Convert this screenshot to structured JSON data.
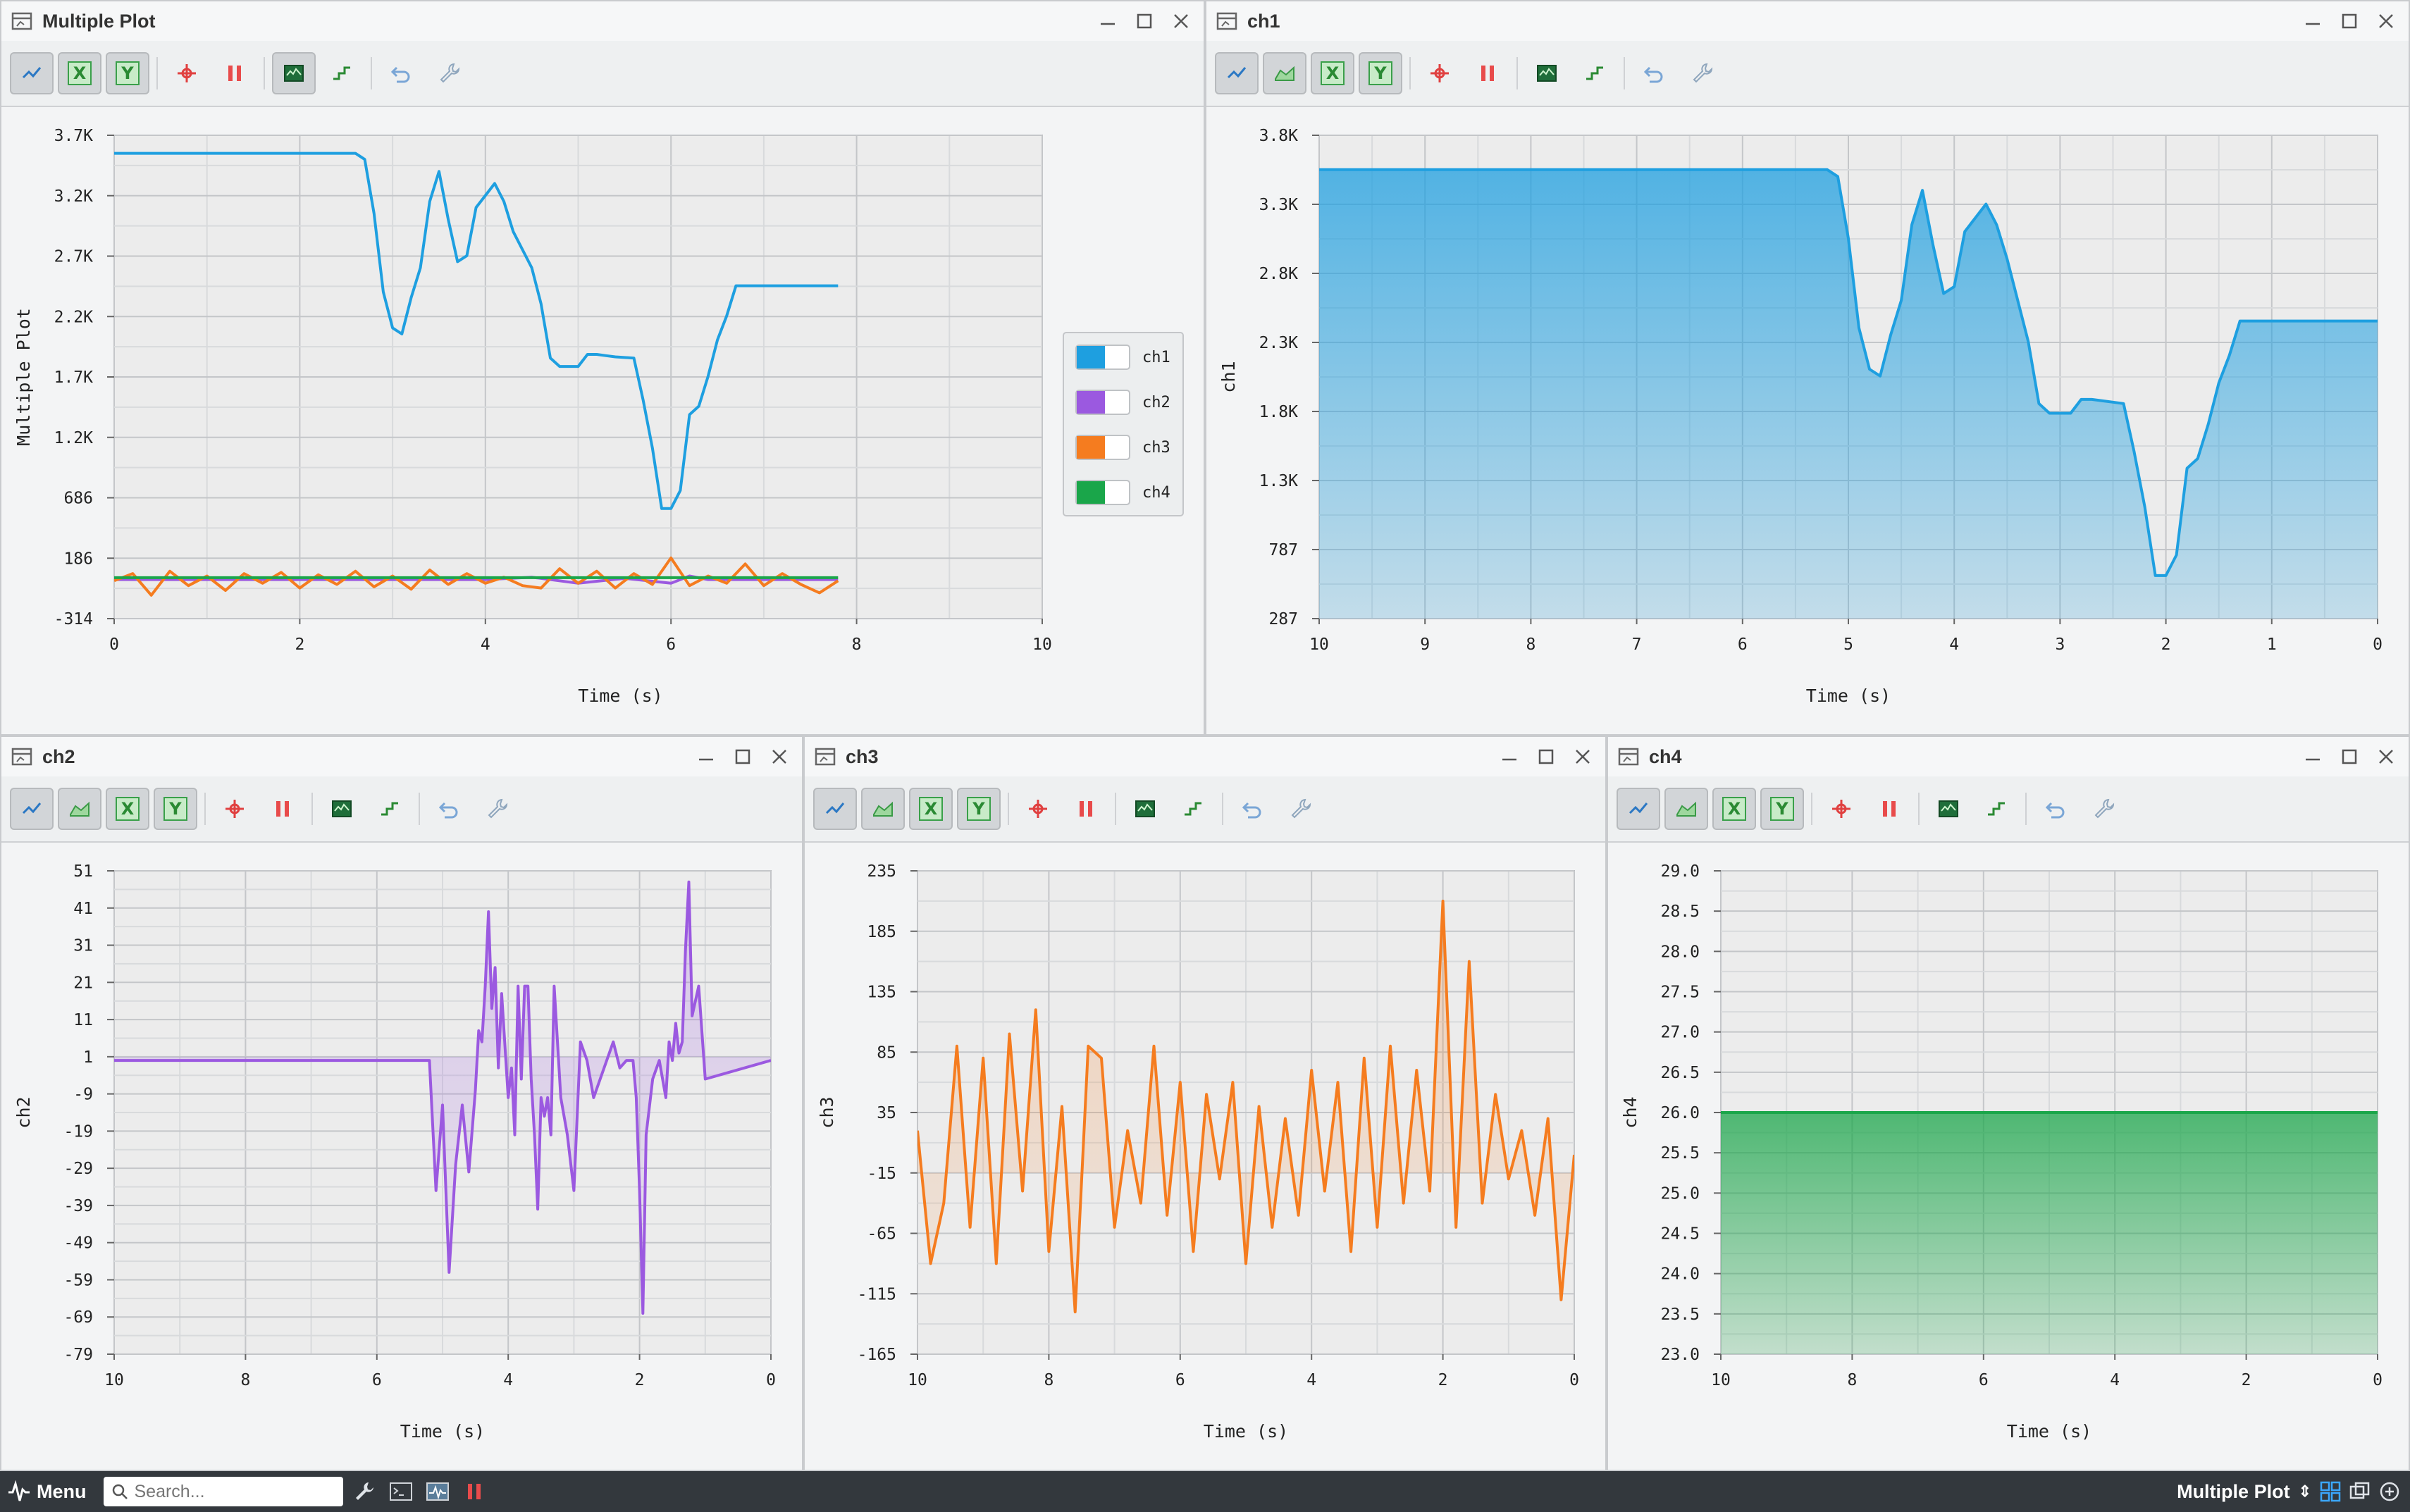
{
  "panels": [
    {
      "id": "p0",
      "title": "Multiple Plot",
      "tools": [
        "line",
        "x",
        "y",
        "move",
        "pause",
        "screenshot",
        "step",
        "undo",
        "settings"
      ]
    },
    {
      "id": "p1",
      "title": "ch1",
      "tools": [
        "line",
        "area",
        "x",
        "y",
        "move",
        "pause",
        "screenshot",
        "step",
        "undo",
        "settings"
      ]
    },
    {
      "id": "p2",
      "title": "ch2",
      "tools": [
        "line",
        "area",
        "x",
        "y",
        "move",
        "pause",
        "screenshot",
        "step",
        "undo",
        "settings"
      ]
    },
    {
      "id": "p3",
      "title": "ch3",
      "tools": [
        "line",
        "area",
        "x",
        "y",
        "move",
        "pause",
        "screenshot",
        "step",
        "undo",
        "settings"
      ]
    },
    {
      "id": "p4",
      "title": "ch4",
      "tools": [
        "line",
        "area",
        "x",
        "y",
        "move",
        "pause",
        "screenshot",
        "step",
        "undo",
        "settings"
      ]
    }
  ],
  "toolbar_labels": {
    "x": "X",
    "y": "Y"
  },
  "taskbar": {
    "menu_label": "Menu",
    "search_placeholder": "Search...",
    "active_window": "Multiple Plot"
  },
  "colors": {
    "ch1": "#1e9fe0",
    "ch2": "#9b59e0",
    "ch3": "#f57c1f",
    "ch4": "#1aa64a",
    "panel_bg": "#f3f4f5",
    "grid": "#c4c6c9",
    "taskbar": "#33383d"
  },
  "chart_data": [
    {
      "panel": "Multiple Plot",
      "type": "line",
      "xlabel": "Time (s)",
      "ylabel": "Multiple Plot",
      "xlim": [
        0,
        10
      ],
      "ylim": [
        -314,
        3700
      ],
      "xticks": [
        "0",
        "2",
        "4",
        "6",
        "8",
        "10"
      ],
      "yticks": [
        "3.7K",
        "3.2K",
        "2.7K",
        "2.2K",
        "1.7K",
        "1.2K",
        "686",
        "186",
        "-314"
      ],
      "legend": [
        "ch1",
        "ch2",
        "ch3",
        "ch4"
      ],
      "legend_position": "right",
      "series": [
        {
          "name": "ch1",
          "color": "#1e9fe0",
          "x": [
            0,
            2.6,
            2.7,
            2.8,
            2.9,
            3.0,
            3.1,
            3.2,
            3.3,
            3.4,
            3.5,
            3.6,
            3.7,
            3.8,
            3.9,
            4.0,
            4.1,
            4.2,
            4.3,
            4.5,
            4.6,
            4.7,
            4.8,
            4.9,
            5.0,
            5.1,
            5.2,
            5.3,
            5.4,
            5.6,
            5.7,
            5.8,
            5.9,
            6.0,
            6.1,
            6.2,
            6.3,
            6.4,
            6.5,
            6.6,
            6.7,
            7.0,
            7.4,
            7.8
          ],
          "y": [
            3550,
            3550,
            3500,
            3050,
            2400,
            2100,
            2050,
            2350,
            2600,
            3150,
            3400,
            3000,
            2650,
            2700,
            3100,
            3200,
            3300,
            3150,
            2900,
            2600,
            2300,
            1850,
            1780,
            1780,
            1780,
            1880,
            1880,
            1870,
            1860,
            1850,
            1500,
            1100,
            600,
            600,
            750,
            1380,
            1450,
            1700,
            2000,
            2200,
            2450,
            2450,
            2450,
            2450
          ]
        },
        {
          "name": "ch2",
          "color": "#9b59e0",
          "x": [
            0,
            4,
            4.5,
            5,
            5.5,
            6,
            6.2,
            6.4,
            7,
            7.8
          ],
          "y": [
            10,
            10,
            30,
            -20,
            20,
            -20,
            40,
            10,
            10,
            10
          ]
        },
        {
          "name": "ch3",
          "color": "#f57c1f",
          "x": [
            0,
            0.2,
            0.4,
            0.6,
            0.8,
            1.0,
            1.2,
            1.4,
            1.6,
            1.8,
            2.0,
            2.2,
            2.4,
            2.6,
            2.8,
            3.0,
            3.2,
            3.4,
            3.6,
            3.8,
            4.0,
            4.2,
            4.4,
            4.6,
            4.8,
            5.0,
            5.2,
            5.4,
            5.6,
            5.8,
            6.0,
            6.2,
            6.4,
            6.6,
            6.8,
            7.0,
            7.2,
            7.4,
            7.6,
            7.8
          ],
          "y": [
            0,
            60,
            -120,
            80,
            -40,
            40,
            -80,
            60,
            -20,
            70,
            -60,
            50,
            -30,
            80,
            -50,
            40,
            -70,
            90,
            -30,
            60,
            -20,
            30,
            -40,
            -60,
            100,
            -20,
            80,
            -60,
            60,
            -30,
            190,
            -40,
            40,
            -20,
            140,
            -40,
            60,
            -30,
            -100,
            0
          ]
        },
        {
          "name": "ch4",
          "color": "#1aa64a",
          "x": [
            0,
            7.8
          ],
          "y": [
            26,
            26
          ]
        }
      ]
    },
    {
      "panel": "ch1",
      "type": "area",
      "xlabel": "Time (s)",
      "ylabel": "ch1",
      "xlim": [
        10,
        0
      ],
      "ylim": [
        287,
        3800
      ],
      "xticks": [
        "10",
        "9",
        "8",
        "7",
        "6",
        "5",
        "4",
        "3",
        "2",
        "1",
        "0"
      ],
      "yticks": [
        "3.8K",
        "3.3K",
        "2.8K",
        "2.3K",
        "1.8K",
        "1.3K",
        "787",
        "287"
      ],
      "series": [
        {
          "name": "ch1",
          "color": "#1e9fe0",
          "x": [
            10,
            5.2,
            5.1,
            5.0,
            4.9,
            4.8,
            4.7,
            4.6,
            4.5,
            4.4,
            4.3,
            4.2,
            4.1,
            4.0,
            3.9,
            3.8,
            3.7,
            3.6,
            3.5,
            3.4,
            3.3,
            3.2,
            3.1,
            3.0,
            2.9,
            2.8,
            2.7,
            2.6,
            2.5,
            2.4,
            2.3,
            2.2,
            2.1,
            2.0,
            1.9,
            1.8,
            1.7,
            1.6,
            1.5,
            1.4,
            1.3,
            1.2,
            1.0,
            0.0
          ],
          "y": [
            3550,
            3550,
            3500,
            3050,
            2400,
            2100,
            2050,
            2350,
            2600,
            3150,
            3400,
            3000,
            2650,
            2700,
            3100,
            3200,
            3300,
            3150,
            2900,
            2600,
            2300,
            1850,
            1780,
            1780,
            1780,
            1880,
            1880,
            1870,
            1860,
            1850,
            1500,
            1100,
            600,
            600,
            750,
            1380,
            1450,
            1700,
            2000,
            2200,
            2450,
            2450,
            2450,
            2450
          ]
        }
      ]
    },
    {
      "panel": "ch2",
      "type": "area",
      "xlabel": "Time (s)",
      "ylabel": "ch2",
      "xlim": [
        10,
        0
      ],
      "ylim": [
        -79,
        51
      ],
      "xticks": [
        "10",
        "8",
        "6",
        "4",
        "2",
        "0"
      ],
      "yticks": [
        "51",
        "41",
        "31",
        "21",
        "11",
        "1",
        "-9",
        "-19",
        "-29",
        "-39",
        "-49",
        "-59",
        "-69",
        "-79"
      ],
      "series": [
        {
          "name": "ch2",
          "color": "#9b59e0",
          "x": [
            10,
            5.2,
            5.1,
            5.0,
            4.9,
            4.8,
            4.7,
            4.6,
            4.5,
            4.45,
            4.4,
            4.35,
            4.3,
            4.25,
            4.2,
            4.15,
            4.1,
            4.0,
            3.95,
            3.9,
            3.85,
            3.8,
            3.75,
            3.7,
            3.65,
            3.6,
            3.55,
            3.5,
            3.45,
            3.4,
            3.35,
            3.3,
            3.2,
            3.1,
            3.0,
            2.9,
            2.8,
            2.7,
            2.6,
            2.5,
            2.4,
            2.3,
            2.2,
            2.1,
            2.05,
            2.0,
            1.95,
            1.9,
            1.8,
            1.7,
            1.6,
            1.55,
            1.5,
            1.45,
            1.4,
            1.35,
            1.3,
            1.25,
            1.2,
            1.1,
            1.0,
            0.0
          ],
          "y": [
            0,
            0,
            -35,
            -12,
            -57,
            -28,
            -12,
            -30,
            -8,
            8,
            5,
            20,
            40,
            14,
            25,
            -2,
            18,
            -10,
            -2,
            -20,
            20,
            -5,
            20,
            20,
            -5,
            -20,
            -40,
            -10,
            -15,
            -10,
            -20,
            20,
            -10,
            -20,
            -35,
            5,
            0,
            -10,
            -5,
            0,
            5,
            -2,
            0,
            0,
            -10,
            -35,
            -68,
            -20,
            -5,
            0,
            -10,
            5,
            0,
            10,
            2,
            5,
            30,
            48,
            12,
            20,
            -5,
            0
          ]
        }
      ]
    },
    {
      "panel": "ch3",
      "type": "area",
      "xlabel": "Time (s)",
      "ylabel": "ch3",
      "xlim": [
        10,
        0
      ],
      "ylim": [
        -165,
        235
      ],
      "xticks": [
        "10",
        "8",
        "6",
        "4",
        "2",
        "0"
      ],
      "yticks": [
        "235",
        "185",
        "135",
        "85",
        "35",
        "-15",
        "-65",
        "-115",
        "-165"
      ],
      "series": [
        {
          "name": "ch3",
          "color": "#f57c1f",
          "x": [
            10,
            9.8,
            9.6,
            9.4,
            9.2,
            9.0,
            8.8,
            8.6,
            8.4,
            8.2,
            8.0,
            7.8,
            7.6,
            7.4,
            7.2,
            7.0,
            6.8,
            6.6,
            6.4,
            6.2,
            6.0,
            5.8,
            5.6,
            5.4,
            5.2,
            5.0,
            4.8,
            4.6,
            4.4,
            4.2,
            4.0,
            3.8,
            3.6,
            3.4,
            3.2,
            3.0,
            2.8,
            2.6,
            2.4,
            2.2,
            2.0,
            1.8,
            1.6,
            1.4,
            1.2,
            1.0,
            0.8,
            0.6,
            0.4,
            0.2,
            0.0
          ],
          "y": [
            20,
            -90,
            -40,
            90,
            -60,
            80,
            -90,
            100,
            -30,
            120,
            -80,
            40,
            -130,
            90,
            80,
            -60,
            20,
            -40,
            90,
            -50,
            60,
            -80,
            50,
            -20,
            60,
            -90,
            40,
            -60,
            30,
            -50,
            70,
            -30,
            60,
            -80,
            80,
            -60,
            90,
            -40,
            70,
            -30,
            210,
            -60,
            160,
            -40,
            50,
            -20,
            20,
            -50,
            30,
            -120,
            0
          ]
        }
      ]
    },
    {
      "panel": "ch4",
      "type": "area",
      "xlabel": "Time (s)",
      "ylabel": "ch4",
      "xlim": [
        10,
        0
      ],
      "ylim": [
        23.0,
        29.0
      ],
      "xticks": [
        "10",
        "8",
        "6",
        "4",
        "2",
        "0"
      ],
      "yticks": [
        "29.0",
        "28.5",
        "28.0",
        "27.5",
        "27.0",
        "26.5",
        "26.0",
        "25.5",
        "25.0",
        "24.5",
        "24.0",
        "23.5",
        "23.0"
      ],
      "series": [
        {
          "name": "ch4",
          "color": "#1aa64a",
          "x": [
            10,
            0
          ],
          "y": [
            26.0,
            26.0
          ]
        }
      ]
    }
  ]
}
